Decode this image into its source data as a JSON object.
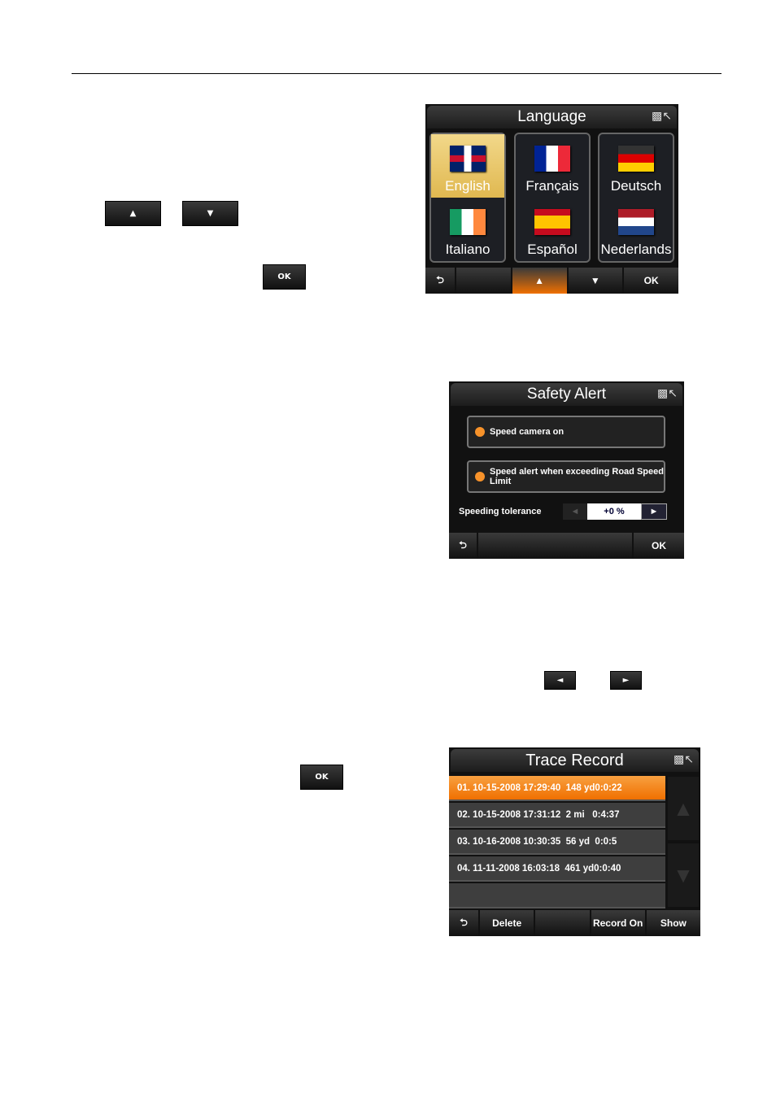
{
  "inline_buttons": {
    "up": "▲",
    "down": "▼",
    "ok1": "OK",
    "left": "◄",
    "right": "►",
    "ok2": "OK"
  },
  "language": {
    "title": "Language",
    "items": [
      {
        "label": "English",
        "flag": "uk",
        "selected": true
      },
      {
        "label": "Français",
        "flag": "fr"
      },
      {
        "label": "Deutsch",
        "flag": "de"
      },
      {
        "label": "Italiano",
        "flag": "ie"
      },
      {
        "label": "Español",
        "flag": "es"
      },
      {
        "label": "Nederlands",
        "flag": "nl"
      }
    ],
    "bar": {
      "back": "⮌",
      "blank": "",
      "up": "▲",
      "down": "▼",
      "ok": "OK"
    }
  },
  "safety": {
    "title": "Safety Alert",
    "opt1": "Speed camera on",
    "opt2": "Speed alert when exceeding Road Speed Limit",
    "tol_label": "Speeding tolerance",
    "tol_value": "+0 %",
    "left": "◄",
    "right": "►",
    "back": "⮌",
    "ok": "OK"
  },
  "trace": {
    "title": "Trace Record",
    "rows": [
      "01. 10-15-2008 17:29:40  148 yd0:0:22",
      "02. 10-15-2008 17:31:12  2 mi   0:4:37",
      "03. 10-16-2008 10:30:35  56 yd  0:0:5",
      "04. 11-11-2008 16:03:18  461 yd0:0:40"
    ],
    "up": "▲",
    "down": "▼",
    "back": "⮌",
    "delete": "Delete",
    "blank": "",
    "record": "Record On",
    "show": "Show"
  },
  "accent": "#f07000"
}
